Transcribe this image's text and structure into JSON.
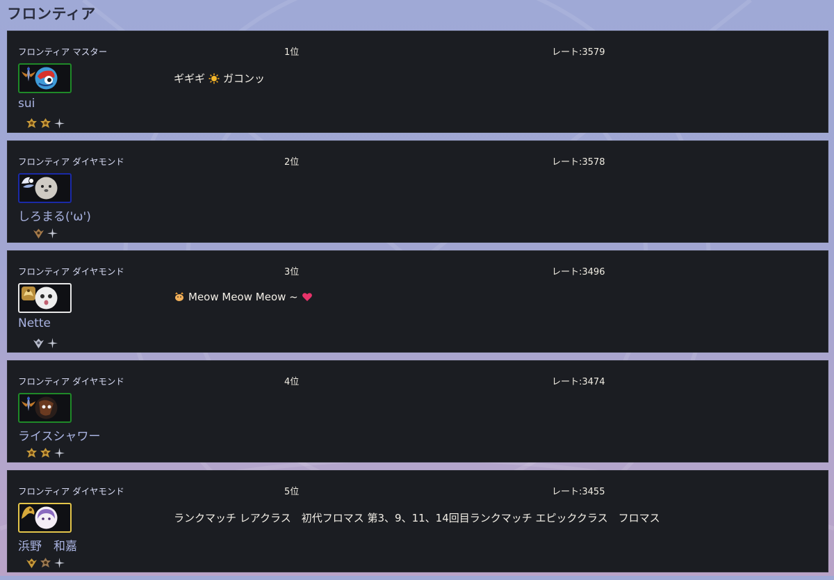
{
  "page": {
    "title": "フロンティア"
  },
  "colors": {
    "card_bg": "#1b1d22",
    "frame_green": "#1f8a28",
    "frame_blue": "#1a2aa8",
    "frame_white": "#e8e8e8",
    "frame_gold": "#e4c64a",
    "name_text": "#aab4e2",
    "heart": "#e8336a"
  },
  "entries": [
    {
      "class_label": "フロンティア マスター",
      "rank": "1位",
      "rate": "レート:3579",
      "name": "sui",
      "frame": "green",
      "emblem_icon": "sword-wing-emblem-icon",
      "portrait_icon": "red-creature-avatar-icon",
      "badges": [
        "gold-crest-badge-icon",
        "gold-crest-badge-icon",
        "sparkle-badge-icon"
      ],
      "comment": {
        "before": "ギギギ",
        "icon": "sun-icon",
        "after": "ガコンッ"
      }
    },
    {
      "class_label": "フロンティア ダイヤモンド",
      "rank": "2位",
      "rate": "レート:3578",
      "name": "しろまる('ω')",
      "frame": "blue",
      "emblem_icon": "white-wing-emblem-icon",
      "portrait_icon": "seal-avatar-icon",
      "badges": [
        "bronze-wing-badge-icon",
        "sparkle-badge-icon"
      ],
      "comment": {
        "before": "",
        "icon": "",
        "after": ""
      }
    },
    {
      "class_label": "フロンティア ダイヤモンド",
      "rank": "3位",
      "rate": "レート:3496",
      "name": "Nette",
      "frame": "white",
      "emblem_icon": "gold-beast-emblem-icon",
      "portrait_icon": "cat-avatar-icon",
      "badges": [
        "silver-wing-badge-icon",
        "sparkle-badge-icon"
      ],
      "comment": {
        "lead_icon": "cat-icon",
        "text": "Meow Meow Meow ~",
        "tail_icon": "heart-icon"
      }
    },
    {
      "class_label": "フロンティア ダイヤモンド",
      "rank": "4位",
      "rate": "レート:3474",
      "name": "ライスシャワー",
      "frame": "green",
      "emblem_icon": "sword-wing-emblem-icon",
      "portrait_icon": "dark-character-avatar-icon",
      "badges": [
        "gold-crest-badge-icon",
        "gold-crest-badge-icon",
        "sparkle-badge-icon"
      ],
      "comment": {
        "before": "",
        "icon": "",
        "after": ""
      }
    },
    {
      "class_label": "フロンティア ダイヤモンド",
      "rank": "5位",
      "rate": "レート:3455",
      "name": "浜野　和嘉",
      "frame": "gold",
      "emblem_icon": "gold-dragon-emblem-icon",
      "portrait_icon": "purple-hair-girl-avatar-icon",
      "badges": [
        "gold-wing-badge-icon",
        "bronze-crest-badge-icon",
        "sparkle-badge-icon"
      ],
      "comment": {
        "text": "ランクマッチ レアクラス　初代フロマス 第3、9、11、14回目ランクマッチ エピッククラス　フロマス"
      }
    }
  ]
}
